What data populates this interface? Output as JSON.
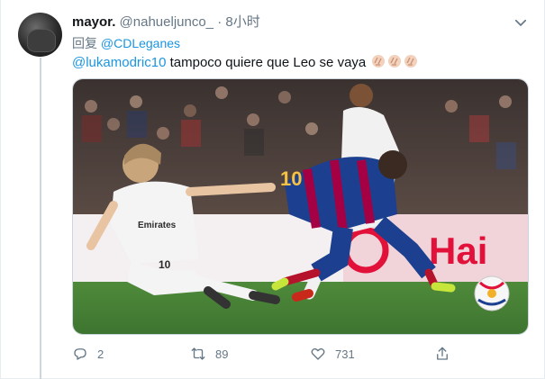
{
  "tweet": {
    "author_name": "mayor.",
    "author_handle": "@nahueljunco_",
    "separator": "·",
    "timestamp": "8小时",
    "replying_label": "回复",
    "replying_to": "@CDLeganes",
    "mention": "@lukamodric10",
    "body_text": " tampoco quiere que Leo se vaya",
    "emoji_count": 3,
    "media": {
      "jersey_modric": "10",
      "sponsor_text": "Emirates",
      "board_text": "Hai"
    },
    "actions": {
      "replies": "2",
      "retweets": "89",
      "likes": "731"
    }
  },
  "colors": {
    "link": "#1b95e0",
    "secondary_text": "#657786",
    "barca_blue": "#1d3f8f",
    "barca_red": "#a50044",
    "board_red": "#e2113a"
  },
  "icons": [
    "caret-down-icon",
    "reply-icon",
    "retweet-icon",
    "like-icon",
    "share-icon",
    "clap-emoji-icon"
  ]
}
